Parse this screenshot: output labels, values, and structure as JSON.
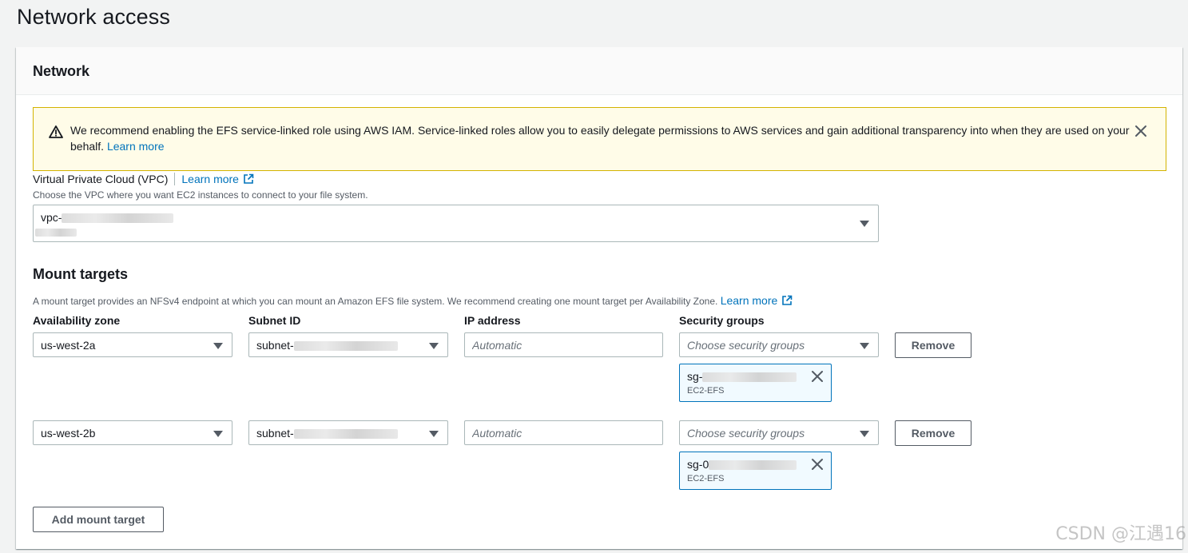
{
  "page": {
    "title": "Network access"
  },
  "network_card": {
    "title": "Network"
  },
  "alert": {
    "text": "We recommend enabling the EFS service-linked role using AWS IAM. Service-linked roles allow you to easily delegate permissions to AWS services and gain additional transparency into when they are used on your behalf.",
    "link": "Learn more",
    "icon": "warning-icon"
  },
  "vpc": {
    "label": "Virtual Private Cloud (VPC)",
    "learn_more": "Learn more",
    "description": "Choose the VPC where you want EC2 instances to connect to your file system.",
    "value_prefix": "vpc-"
  },
  "mount_targets": {
    "title": "Mount targets",
    "description": "A mount target provides an NFSv4 endpoint at which you can mount an Amazon EFS file system. We recommend creating one mount target per Availability Zone.",
    "learn_more": "Learn more",
    "columns": [
      "Availability zone",
      "Subnet ID",
      "IP address",
      "Security groups"
    ],
    "ip_placeholder": "Automatic",
    "sg_placeholder": "Choose security groups",
    "remove_label": "Remove",
    "rows": [
      {
        "az": "us-west-2a",
        "subnet_prefix": "subnet-",
        "sg_prefix": "sg-",
        "sg_name": "EC2-EFS"
      },
      {
        "az": "us-west-2b",
        "subnet_prefix": "subnet-",
        "sg_prefix": "sg-0",
        "sg_name": "EC2-EFS"
      }
    ],
    "add_label": "Add mount target"
  },
  "watermark": "CSDN @江遇16",
  "colors": {
    "link": "#0073bb",
    "alert_bg": "#fffce8",
    "alert_border": "#d3b300",
    "token_border": "#0073bb"
  }
}
